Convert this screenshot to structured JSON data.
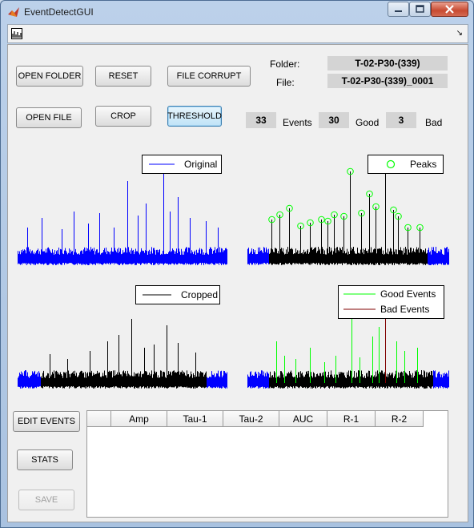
{
  "window": {
    "title": "EventDetectGUI"
  },
  "buttons": {
    "open_folder": "OPEN FOLDER",
    "reset": "RESET",
    "file_corrupt": "FILE CORRUPT",
    "open_file": "OPEN FILE",
    "crop": "CROP",
    "threshold": "THRESHOLD",
    "edit_events": "EDIT EVENTS",
    "stats": "STATS",
    "save": "SAVE"
  },
  "info": {
    "folder_label": "Folder:",
    "folder_value": "T-02-P30-(339)",
    "file_label": "File:",
    "file_value": "T-02-P30-(339)_0001",
    "events_count": "33",
    "events_label": "Events",
    "good_count": "30",
    "good_label": "Good",
    "bad_count": "3",
    "bad_label": "Bad"
  },
  "plots": {
    "original": {
      "legend": "Original",
      "color": "#0000ff"
    },
    "peaks": {
      "legend": "Peaks",
      "color": "#00ff00"
    },
    "cropped": {
      "legend": "Cropped",
      "color": "#000000"
    },
    "good_bad": {
      "legend_good": "Good Events",
      "legend_bad": "Bad Events",
      "good_color": "#00ff00",
      "bad_color": "#800000"
    }
  },
  "table": {
    "columns": [
      "",
      "Amp",
      "Tau-1",
      "Tau-2",
      "AUC",
      "R-1",
      "R-2"
    ]
  }
}
